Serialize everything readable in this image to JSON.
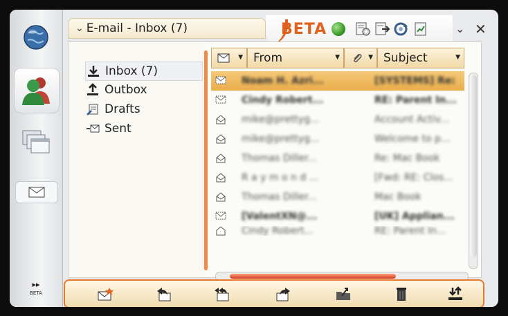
{
  "header": {
    "title": "E-mail - Inbox (7)",
    "badge": "BETA"
  },
  "sidebar": {
    "more_label": "▸▸",
    "more_sub": "BETA"
  },
  "folders": [
    {
      "label": "Inbox (7)",
      "icon": "inbox-icon"
    },
    {
      "label": "Outbox",
      "icon": "outbox-icon"
    },
    {
      "label": "Drafts",
      "icon": "drafts-icon"
    },
    {
      "label": "Sent",
      "icon": "sent-icon"
    }
  ],
  "columns": {
    "from": "From",
    "subject": "Subject"
  },
  "messages": [
    {
      "from": "Noam H. Azri...",
      "subject": "[SYSTEMS] Re:",
      "read": false,
      "selected": true
    },
    {
      "from": "Cindy Robert...",
      "subject": "RE: Parent In...",
      "read": false
    },
    {
      "from": "mike@prettyg...",
      "subject": "Account Activ...",
      "read": true
    },
    {
      "from": "mike@prettyg...",
      "subject": "Welcome to p...",
      "read": true
    },
    {
      "from": "Thomas Diller...",
      "subject": "Re: Mac Book",
      "read": true
    },
    {
      "from": "R a y m o n d ...",
      "subject": "[Fwd: RE: Clos...",
      "read": true
    },
    {
      "from": "Thomas Diller...",
      "subject": "Mac Book",
      "read": true
    },
    {
      "from": "[ValentXN@...",
      "subject": "[UK] Applian...",
      "read": false
    },
    {
      "from": "Cindy Robert...",
      "subject": "RE: Parent In...",
      "read": false
    }
  ],
  "toolbar": [
    "new-message-icon",
    "reply-icon",
    "reply-all-icon",
    "forward-icon",
    "move-to-folder-icon",
    "delete-icon",
    "send-receive-icon"
  ]
}
